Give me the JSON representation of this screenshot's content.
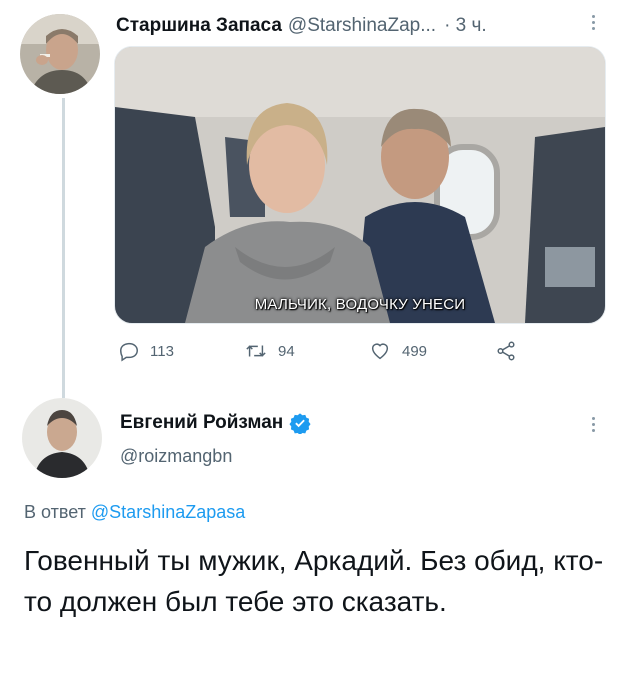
{
  "tweet1": {
    "author_name": "Старшина Запаса",
    "author_handle": "@StarshinaZap...",
    "time": "· 3 ч.",
    "image_caption": "МАЛЬЧИК, ВОДОЧКУ УНЕСИ",
    "stats": {
      "replies": "113",
      "retweets": "94",
      "likes": "499"
    }
  },
  "tweet2": {
    "author_name": "Евгений Ройзман",
    "author_handle": "@roizmangbn",
    "replying_prefix": "В ответ",
    "replying_to": "@StarshinaZapasa",
    "text": "Говенный ты мужик, Аркадий. Без обид, кто-то должен был тебе это сказать."
  },
  "colors": {
    "text_primary": "#0f1419",
    "text_secondary": "#536471",
    "link": "#1d9bf0",
    "verified": "#1d9bf0",
    "thread_line": "#cfd9de"
  },
  "icons": [
    "reply-icon",
    "retweet-icon",
    "like-icon",
    "share-icon",
    "verified-badge-icon",
    "more-options-icon"
  ]
}
